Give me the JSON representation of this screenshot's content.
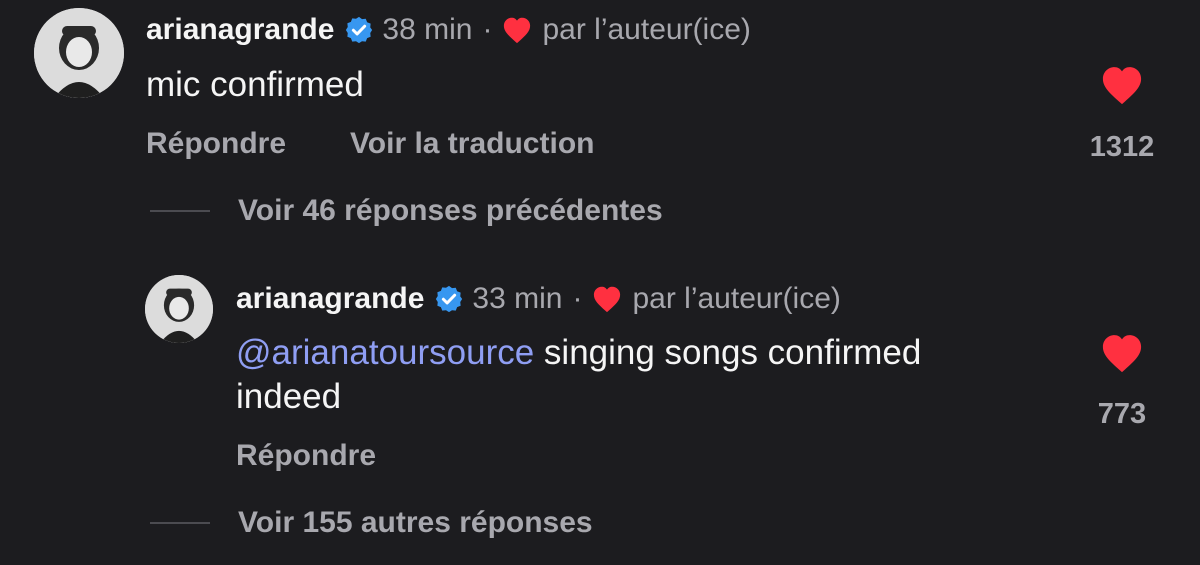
{
  "colors": {
    "background": "#1c1c1f",
    "primary_text": "#f5f5f5",
    "secondary_text": "#a8a8ae",
    "mention": "#8f9ef3",
    "heart": "#ff3040",
    "verified": "#3797f0"
  },
  "icons": {
    "verified": "verified-badge-icon",
    "small_heart": "heart-icon",
    "like": "heart-filled-icon"
  },
  "comment": {
    "username": "arianagrande",
    "time": "38 min",
    "separator": "·",
    "liked_by": "par l’auteur(ice)",
    "text": "mic confirmed",
    "reply_label": "Répondre",
    "translate_label": "Voir la traduction",
    "likes": "1312"
  },
  "previous_replies": {
    "label": "Voir 46 réponses précédentes"
  },
  "reply": {
    "username": "arianagrande",
    "time": "33 min",
    "separator": "·",
    "liked_by": "par l’auteur(ice)",
    "mention": "@arianatoursource",
    "text_line1": " singing songs confirmed",
    "text_line2": "indeed",
    "reply_label": "Répondre",
    "likes": "773"
  },
  "more_replies": {
    "label": "Voir 155 autres réponses"
  }
}
